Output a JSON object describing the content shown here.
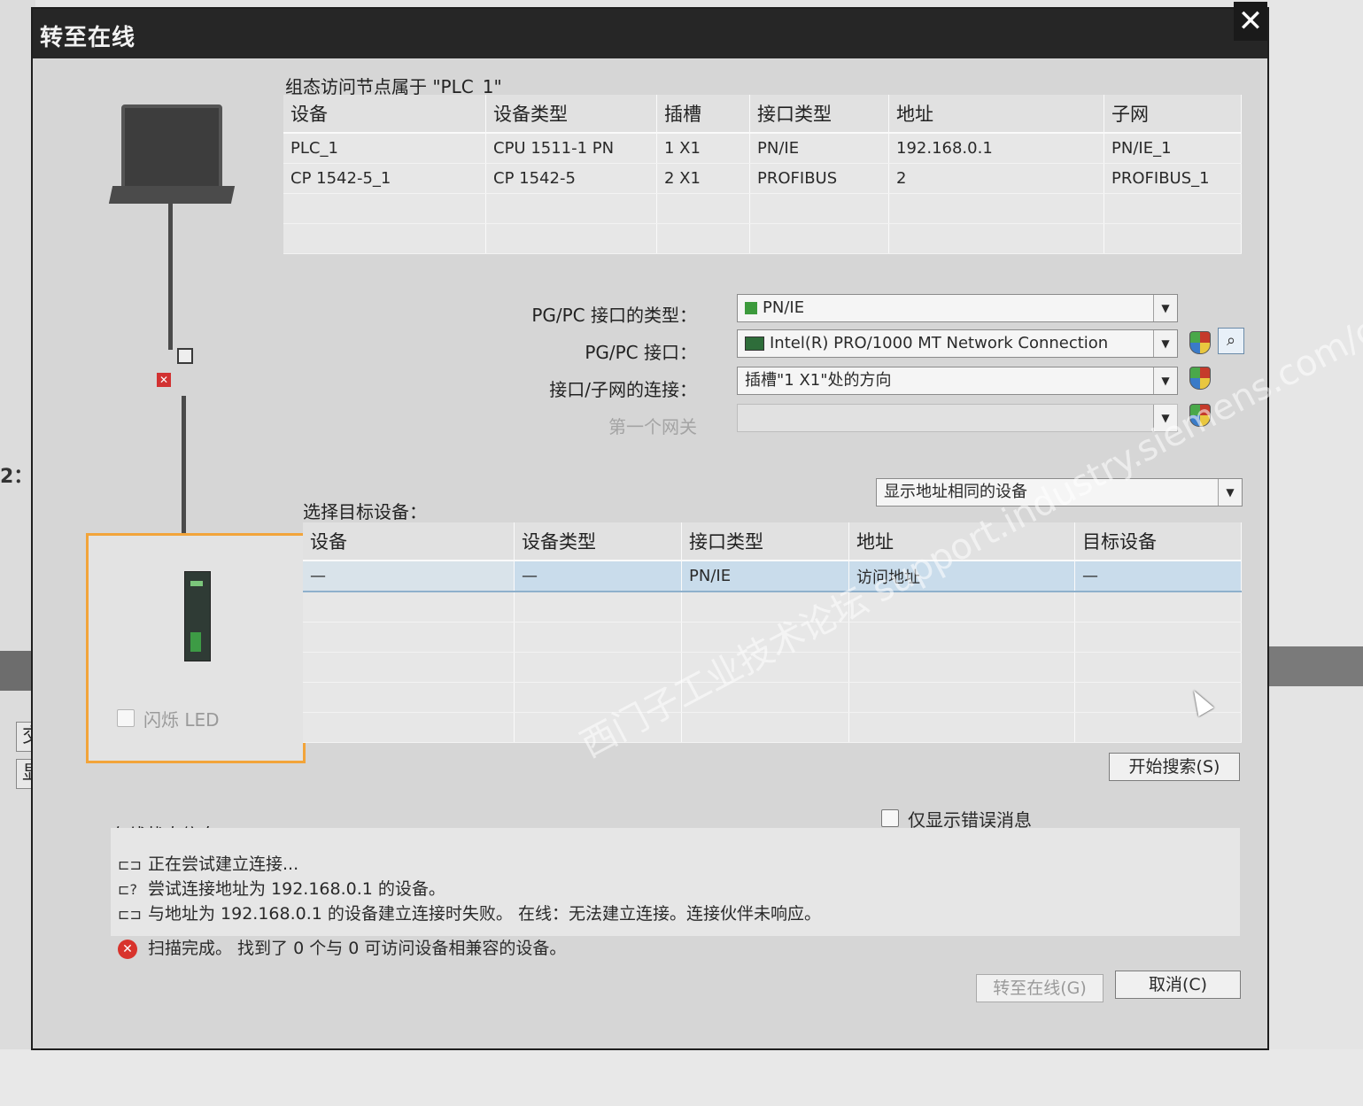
{
  "dialog": {
    "title": "转至在线",
    "close_glyph": "✕"
  },
  "config_table": {
    "heading": "组态访问节点属于 \"PLC_1\"",
    "columns": [
      "设备",
      "设备类型",
      "插槽",
      "接口类型",
      "地址",
      "子网"
    ],
    "rows": [
      [
        "PLC_1",
        "CPU 1511-1 PN",
        "1 X1",
        "PN/IE",
        "192.168.0.1",
        "PN/IE_1"
      ],
      [
        "CP 1542-5_1",
        "CP 1542-5",
        "2 X1",
        "PROFIBUS",
        "2",
        "PROFIBUS_1"
      ],
      [
        "",
        "",
        "",
        "",
        "",
        ""
      ],
      [
        "",
        "",
        "",
        "",
        "",
        ""
      ]
    ]
  },
  "form": {
    "pgpc_type_label": "PG/PC 接口的类型：",
    "pgpc_type_value": "PN/IE",
    "pgpc_iface_label": "PG/PC 接口：",
    "pgpc_iface_value": "Intel(R) PRO/1000 MT Network Connection",
    "subnet_conn_label": "接口/子网的连接：",
    "subnet_conn_value": "插槽\"1 X1\"处的方向",
    "gateway_label": "第一个网关",
    "gateway_value": ""
  },
  "target": {
    "heading": "选择目标设备：",
    "filter_value": "显示地址相同的设备",
    "columns": [
      "设备",
      "设备类型",
      "接口类型",
      "地址",
      "目标设备"
    ],
    "rows": [
      [
        "—",
        "—",
        "PN/IE",
        "访问地址",
        "—"
      ],
      [
        "",
        "",
        "",
        "",
        ""
      ],
      [
        "",
        "",
        "",
        "",
        ""
      ],
      [
        "",
        "",
        "",
        "",
        ""
      ],
      [
        "",
        "",
        "",
        "",
        ""
      ],
      [
        "",
        "",
        "",
        "",
        ""
      ]
    ],
    "search_button": "开始搜索(S)"
  },
  "left_panel": {
    "flash_led_label": "闪烁 LED"
  },
  "status": {
    "heading": "在线状态信息：",
    "errors_only_label": "仅显示错误消息",
    "messages": [
      {
        "icon": "network-icon",
        "text": "正在尝试建立连接..."
      },
      {
        "icon": "network-question-icon",
        "text": "尝试连接地址为 192.168.0.1 的设备。"
      },
      {
        "icon": "network-icon",
        "text": "与地址为 192.168.0.1 的设备建立连接时失败。 在线：无法建立连接。连接伙伴未响应。"
      },
      {
        "icon": "error-icon",
        "text": "扫描完成。 找到了 0 个与 0 可访问设备相兼容的设备。"
      }
    ]
  },
  "footer": {
    "goonline_button": "转至在线(G)",
    "cancel_button": "取消(C)"
  },
  "background": {
    "left_label": "2：",
    "btn_cross": "交叉",
    "btn_show": "显示所"
  },
  "watermark": "西门子工业技术论坛 support.industry.siemens.com/cs",
  "colors": {
    "selection": "#c9dceb",
    "panel_highlight": "#f2a43a",
    "error": "#d8332c"
  }
}
